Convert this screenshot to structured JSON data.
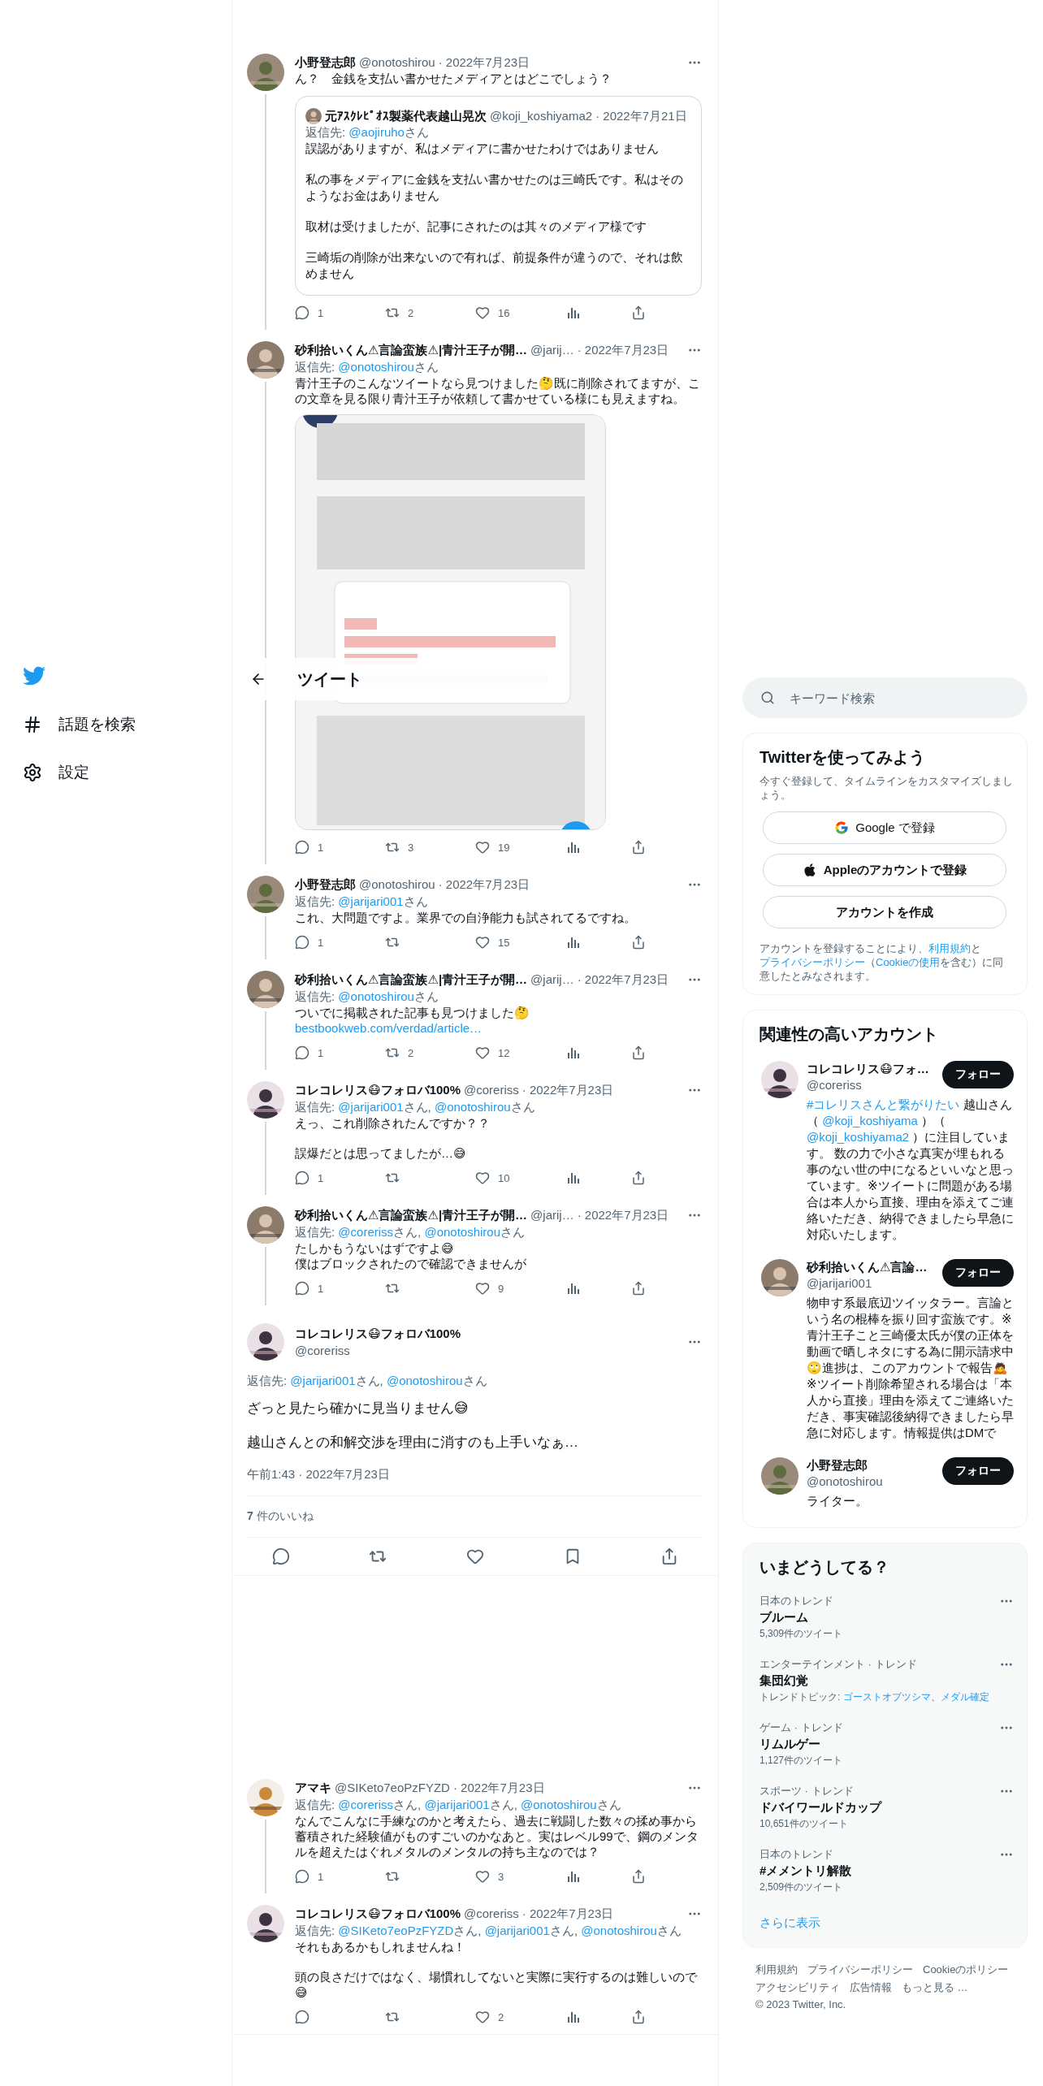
{
  "nav": {
    "items": [
      {
        "kind": "logo"
      },
      {
        "kind": "explore",
        "label": "話題を検索"
      },
      {
        "kind": "settings",
        "label": "設定"
      }
    ]
  },
  "header": {
    "title": "ツイート"
  },
  "thread": [
    {
      "name": "小野登志郎",
      "handle": "@onotoshirou",
      "date": "· 2022年7月23日",
      "connected": true,
      "paragraphs": [
        "ん？　金銭を支払い書かせたメディアとはどこでしょう？"
      ],
      "quote": {
        "name": "元ｱｽｸﾚﾋﾟｵｽ製薬代表越山晃次",
        "handle": "@koji_koshiyama2",
        "date": "· 2022年7月21日",
        "reply_to": [
          {
            "text": "返信先: ",
            "link": false
          },
          {
            "text": "@aojiruho",
            "link": true
          },
          {
            "text": "さん",
            "link": false
          }
        ],
        "paragraphs": [
          "誤認がありますが、私はメディアに書かせたわけではありません",
          "私の事をメディアに金銭を支払い書かせたのは三崎氏です。私はそのようなお金はありません",
          "取材は受けましたが、記事にされたのは其々のメディア様です",
          "三崎垢の削除が出来ないので有れば、前提条件が違うので、それは飲めません"
        ]
      },
      "stats": {
        "replies": "1",
        "retweets": "2",
        "likes": "16"
      }
    },
    {
      "name": "砂利拾いくん⚠言論蛮族⚠|青汁王子が開…",
      "handle": "@jarij…",
      "date": "· 2022年7月23日",
      "connected": true,
      "reply_to": [
        {
          "text": "返信先: ",
          "link": false
        },
        {
          "text": "@onotoshirou",
          "link": true
        },
        {
          "text": "さん",
          "link": false
        }
      ],
      "paragraphs": [
        "青汁王子のこんなツイートなら見つけました🤔既に削除されてますが、この文章を見る限り青汁王子が依頼して書かせている様にも見えますね。"
      ],
      "media": {
        "kind": "picture"
      },
      "stats": {
        "replies": "1",
        "retweets": "3",
        "likes": "19"
      }
    },
    {
      "name": "小野登志郎",
      "handle": "@onotoshirou",
      "date": "· 2022年7月23日",
      "connected": true,
      "reply_to": [
        {
          "text": "返信先: ",
          "link": false
        },
        {
          "text": "@jarijari001",
          "link": true
        },
        {
          "text": "さん",
          "link": false
        }
      ],
      "paragraphs": [
        "これ、大問題ですよ。業界での自浄能力も試されてるですね。"
      ],
      "stats": {
        "replies": "1",
        "likes": "15"
      }
    },
    {
      "name": "砂利拾いくん⚠言論蛮族⚠|青汁王子が開…",
      "handle": "@jarij…",
      "date": "· 2022年7月23日",
      "connected": true,
      "reply_to": [
        {
          "text": "返信先: ",
          "link": false
        },
        {
          "text": "@onotoshirou",
          "link": true
        },
        {
          "text": "さん",
          "link": false
        }
      ],
      "paragraphs": [
        "ついでに掲載された記事も見つけました🤔"
      ],
      "link": "bestbookweb.com/verdad/article…",
      "stats": {
        "replies": "1",
        "retweets": "2",
        "likes": "12"
      }
    },
    {
      "name": "コレコレリス😷フォロバ100%",
      "handle": "@coreriss",
      "date": "· 2022年7月23日",
      "connected": true,
      "reply_to": [
        {
          "text": "返信先: ",
          "link": false
        },
        {
          "text": "@jarijari001",
          "link": true
        },
        {
          "text": "さん, ",
          "link": false
        },
        {
          "text": "@onotoshirou",
          "link": true
        },
        {
          "text": "さん",
          "link": false
        }
      ],
      "paragraphs": [
        "えっ、これ削除されたんですか？？",
        "誤爆だとは思ってましたが…😅"
      ],
      "stats": {
        "replies": "1",
        "likes": "10"
      }
    },
    {
      "name": "砂利拾いくん⚠言論蛮族⚠|青汁王子が開…",
      "handle": "@jarij…",
      "date": "· 2022年7月23日",
      "connected": true,
      "reply_to": [
        {
          "text": "返信先: ",
          "link": false
        },
        {
          "text": "@coreriss",
          "link": true
        },
        {
          "text": "さん, ",
          "link": false
        },
        {
          "text": "@onotoshirou",
          "link": true
        },
        {
          "text": "さん",
          "link": false
        }
      ],
      "paragraphs": [
        "たしかもうないはずですよ😅\n僕はブロックされたので確認できませんが"
      ],
      "stats": {
        "replies": "1",
        "likes": "9"
      }
    }
  ],
  "focus": {
    "name": "コレコレリス😷フォロバ100%",
    "handle": "@coreriss",
    "reply_to": [
      {
        "text": "返信先: ",
        "link": false
      },
      {
        "text": "@jarijari001",
        "link": true
      },
      {
        "text": "さん, ",
        "link": false
      },
      {
        "text": "@onotoshirou",
        "link": true
      },
      {
        "text": "さん",
        "link": false
      }
    ],
    "paragraphs": [
      "ざっと見たら確かに見当りません😅",
      "越山さんとの和解交渉を理由に消すのも上手いなぁ…"
    ],
    "time": "午前1:43 · 2022年7月23日",
    "likes": "**7** 件のいいね"
  },
  "replies": [
    {
      "name": "アマキ",
      "handle": "@SIKeto7eoPzFYZD",
      "date": "· 2022年7月23日",
      "connected": true,
      "reply_to": [
        {
          "text": "返信先: ",
          "link": false
        },
        {
          "text": "@coreriss",
          "link": true
        },
        {
          "text": "さん, ",
          "link": false
        },
        {
          "text": "@jarijari001",
          "link": true
        },
        {
          "text": "さん, ",
          "link": false
        },
        {
          "text": "@onotoshirou",
          "link": true
        },
        {
          "text": "さん",
          "link": false
        }
      ],
      "paragraphs": [
        "なんでこんなに手練なのかと考えたら、過去に戦闘した数々の揉め事から蓄積された経験値がものすごいのかなあと。実はレベル99で、鋼のメンタルを超えたはぐれメタルのメンタルの持ち主なのでは？"
      ],
      "stats": {
        "replies": "1",
        "likes": "3"
      }
    },
    {
      "name": "コレコレリス😷フォロバ100%",
      "handle": "@coreriss",
      "date": "· 2022年7月23日",
      "connected": false,
      "reply_to": [
        {
          "text": "返信先: ",
          "link": false
        },
        {
          "text": "@SIKeto7eoPzFYZD",
          "link": true
        },
        {
          "text": "さん, ",
          "link": false
        },
        {
          "text": "@jarijari001",
          "link": true
        },
        {
          "text": "さん, ",
          "link": false
        },
        {
          "text": "@onotoshirou",
          "link": true
        },
        {
          "text": "さん",
          "link": false
        }
      ],
      "paragraphs": [
        "それもあるかもしれませんね！",
        "頭の良さだけではなく、場慣れしてないと実際に実行するのは難しいので😅"
      ],
      "stats": {
        "likes": "2"
      }
    }
  ],
  "sidebar": {
    "search": {
      "placeholder": "キーワード検索"
    },
    "signup": {
      "title": "Twitterを使ってみよう",
      "subtitle": "今すぐ登録して、タイムラインをカスタマイズしましょう。",
      "buttons": [
        {
          "kind": "google",
          "label": "Google で登録"
        },
        {
          "kind": "apple",
          "label": "Appleのアカウントで登録"
        },
        {
          "kind": "plain",
          "label": "アカウントを作成"
        }
      ],
      "terms": [
        {
          "text": "アカウントを登録することにより、",
          "link": false
        },
        {
          "text": "利用規約",
          "link": true
        },
        {
          "text": "と",
          "link": false
        },
        {
          "text": "プライバシーポリシー",
          "link": true
        },
        {
          "text": "（",
          "link": false
        },
        {
          "text": "Cookieの使用",
          "link": true
        },
        {
          "text": "を含む）に同意したとみなされます。",
          "link": false
        }
      ]
    },
    "accounts": {
      "title": "関連性の高いアカウント",
      "items": [
        {
          "name": "コレコレリス😷フォ…",
          "handle": "@coreriss",
          "button": "フォロー",
          "bio": [
            {
              "text": "#コレリスさんと繋がりたい",
              "link": true
            },
            {
              "text": " 越山さん（ ",
              "link": false
            },
            {
              "text": "@koji_koshiyama",
              "link": true
            },
            {
              "text": " ）（ ",
              "link": false
            },
            {
              "text": "@koji_koshiyama2",
              "link": true
            },
            {
              "text": " ）に注目しています。 数の力で小さな真実が埋もれる事のない世の中になるといいなと思っています。※ツイートに問題がある場合は本人から直接、理由を添えてご連絡いただき、納得できましたら早急に対応いたします。",
              "link": false
            }
          ]
        },
        {
          "name": "砂利拾いくん⚠言論…",
          "handle": "@jarijari001",
          "button": "フォロー",
          "bio": [
            {
              "text": "物申す系最底辺ツイッタラー。言論という名の棍棒を振り回す蛮族です。※青汁王子こと三崎優太氏が僕の正体を動画で晒しネタにする為に開示請求中🙄進捗は、このアカウントで報告🙇※ツイート削除希望される場合は「本人から直接」理由を添えてご連絡いただき、事実確認後納得できましたら早急に対応します。情報提供はDMで",
              "link": false
            }
          ]
        },
        {
          "name": "小野登志郎",
          "handle": "@onotoshirou",
          "button": "フォロー",
          "bio": [
            {
              "text": "ライター。",
              "link": false
            }
          ]
        }
      ]
    },
    "trends": {
      "title": "いまどうしてる？",
      "items": [
        {
          "context": "日本のトレンド",
          "name": "ブルーム",
          "detail": [
            {
              "text": "5,309件のツイート",
              "link": false
            }
          ]
        },
        {
          "context": "エンターテインメント · トレンド",
          "name": "集団幻覚",
          "detail": [
            {
              "text": "トレンドトピック: ",
              "link": false
            },
            {
              "text": "ゴーストオブツシマ",
              "link": true
            },
            {
              "text": "、",
              "link": false
            },
            {
              "text": "メダル確定",
              "link": true
            }
          ]
        },
        {
          "context": "ゲーム · トレンド",
          "name": "リムルゲー",
          "detail": [
            {
              "text": "1,127件のツイート",
              "link": false
            }
          ]
        },
        {
          "context": "スポーツ · トレンド",
          "name": "ドバイワールドカップ",
          "detail": [
            {
              "text": "10,651件のツイート",
              "link": false
            }
          ]
        },
        {
          "context": "日本のトレンド",
          "name": "#メメントリ解散",
          "detail": [
            {
              "text": "2,509件のツイート",
              "link": false
            }
          ]
        }
      ],
      "more": "さらに表示"
    },
    "footer": [
      "利用規約",
      "プライバシーポリシー",
      "Cookieのポリシー",
      "アクセシビリティ",
      "広告情報",
      "もっと見る …",
      "© 2023 Twitter, Inc."
    ]
  }
}
